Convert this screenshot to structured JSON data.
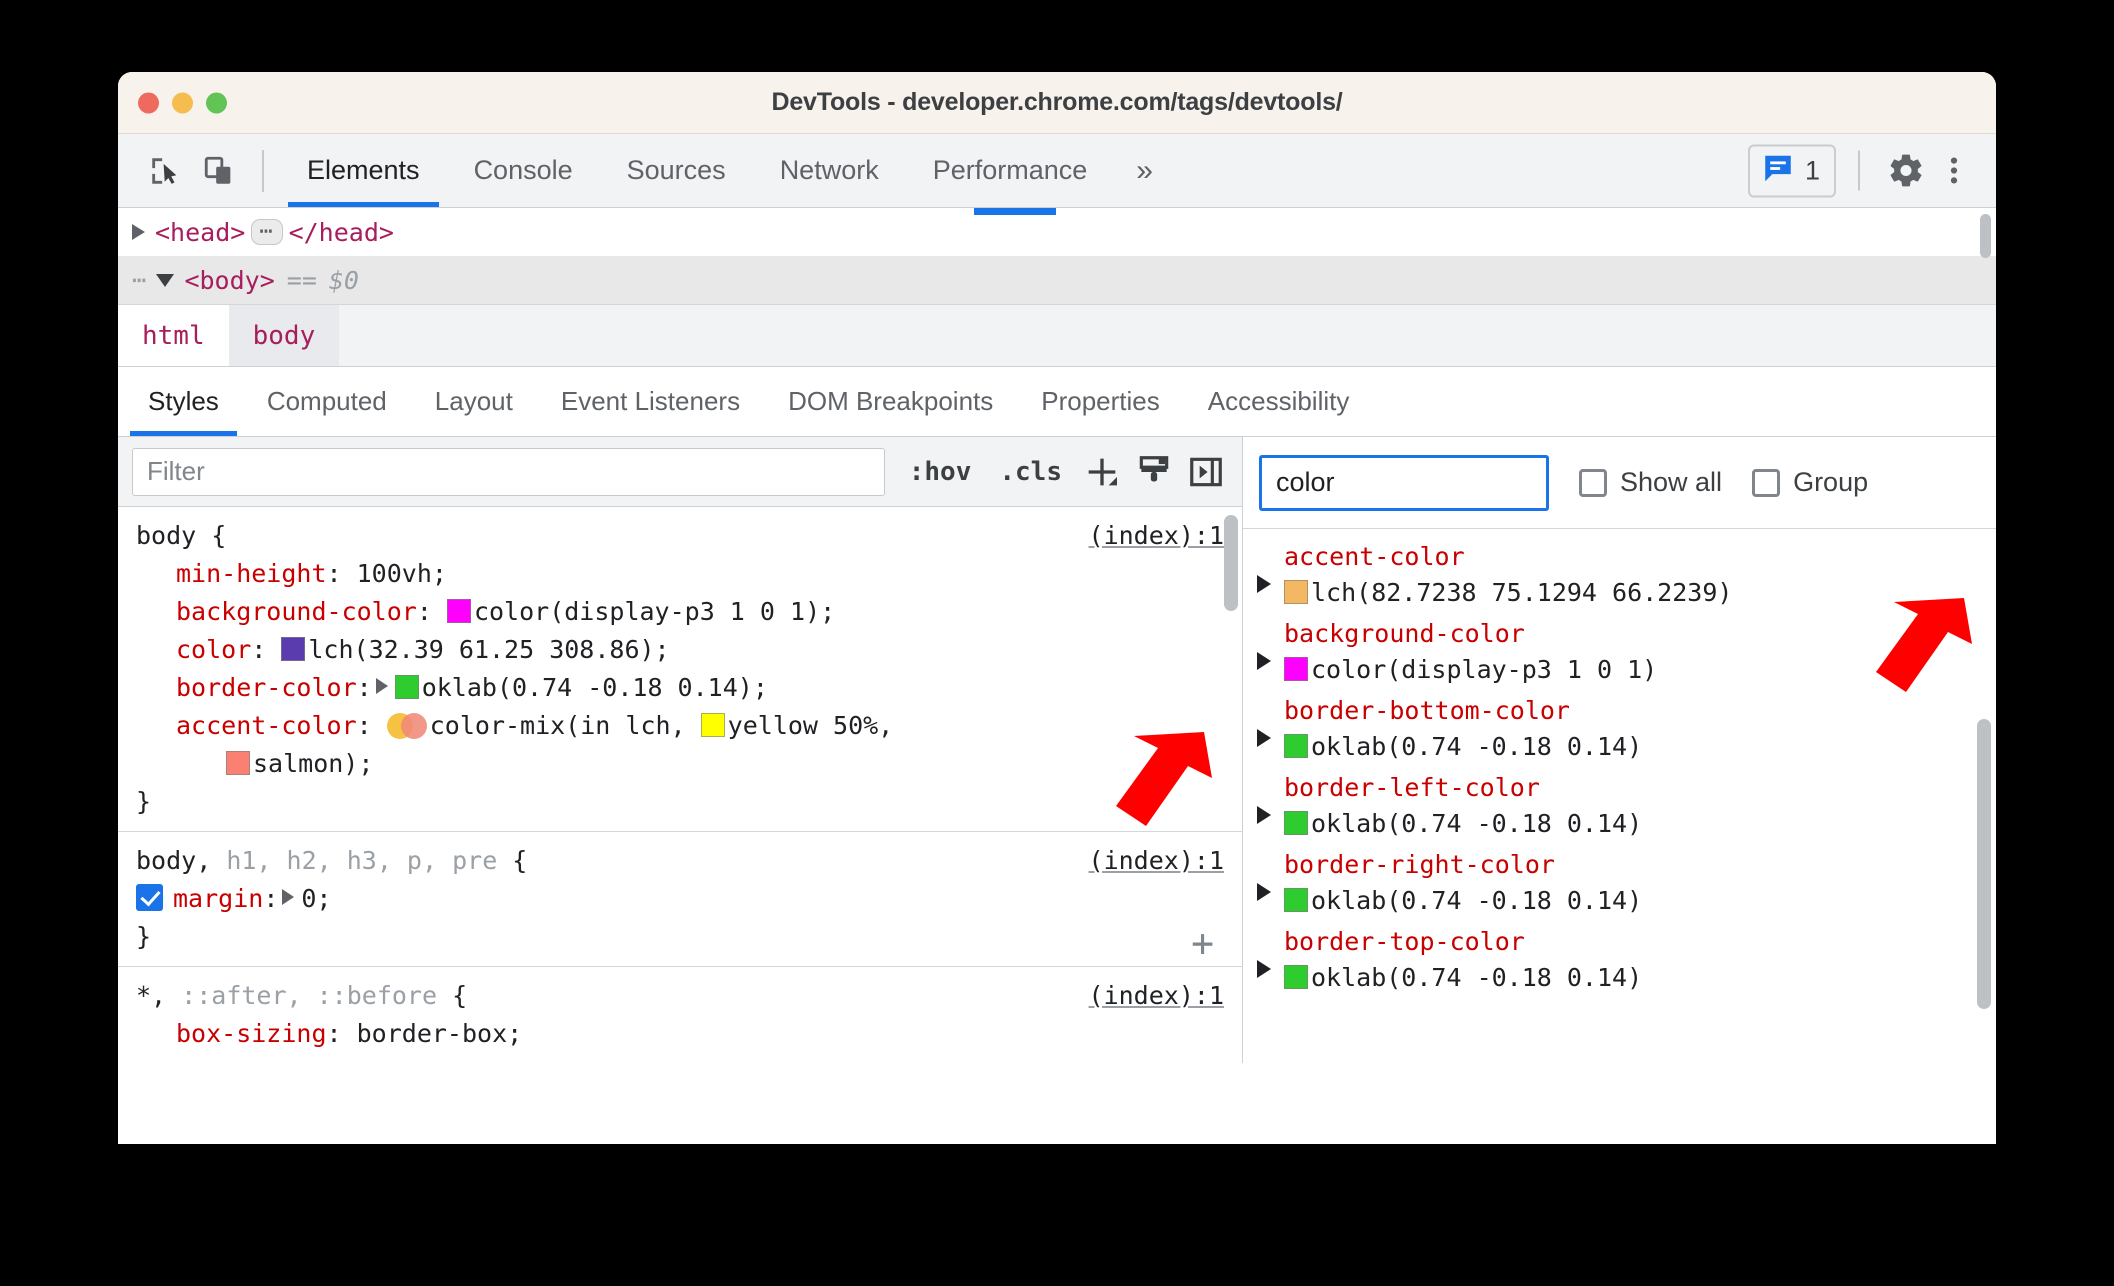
{
  "window": {
    "title": "DevTools - developer.chrome.com/tags/devtools/",
    "traffic_lights": [
      "close",
      "minimize",
      "zoom"
    ]
  },
  "toolbar": {
    "icons": [
      {
        "name": "inspect-element-icon",
        "label": "Inspect"
      },
      {
        "name": "device-toolbar-icon",
        "label": "Toggle device toolbar"
      }
    ],
    "tabs": [
      {
        "label": "Elements",
        "active": true
      },
      {
        "label": "Console",
        "active": false
      },
      {
        "label": "Sources",
        "active": false
      },
      {
        "label": "Network",
        "active": false
      },
      {
        "label": "Performance",
        "active": false
      }
    ],
    "more_tabs_label": "»",
    "issues_count": "1",
    "settings_label": "Settings",
    "menu_label": "Customize and control DevTools"
  },
  "dom_tree": {
    "rows": [
      {
        "gutter": "",
        "marker": "right",
        "open_tag": "<head>",
        "badge": "⋯",
        "close_tag": "</head>",
        "selected": false
      },
      {
        "gutter": "⋯",
        "marker": "down",
        "open_tag": "<body>",
        "eq": "==",
        "ref": "$0",
        "selected": true
      }
    ]
  },
  "breadcrumb": {
    "items": [
      {
        "label": "html",
        "selected": false
      },
      {
        "label": "body",
        "selected": true
      }
    ]
  },
  "sidebar_tabs": [
    {
      "label": "Styles",
      "active": true
    },
    {
      "label": "Computed",
      "active": false
    },
    {
      "label": "Layout",
      "active": false
    },
    {
      "label": "Event Listeners",
      "active": false
    },
    {
      "label": "DOM Breakpoints",
      "active": false
    },
    {
      "label": "Properties",
      "active": false
    },
    {
      "label": "Accessibility",
      "active": false
    }
  ],
  "styles_toolbar": {
    "filter_placeholder": "Filter",
    "filter_value": "",
    "hov_label": ":hov",
    "cls_label": ".cls",
    "new_rule_label": "+",
    "copy_styles_label": "Copy all declarations",
    "computed_sidebar_label": "Toggle computed sidebar"
  },
  "style_rules": [
    {
      "selector_match": "body",
      "selector_rest": "",
      "brace": "{",
      "origin": "(index):1",
      "declarations": [
        {
          "property": "min-height",
          "value": "100vh;",
          "swatch": null
        },
        {
          "property": "background-color",
          "value": "color(display-p3 1 0 1);",
          "swatch": "#ff00ff"
        },
        {
          "property": "color",
          "value": "lch(32.39 61.25 308.86);",
          "swatch": "#5b3cae"
        },
        {
          "property": "border-color",
          "value": "oklab(0.74 -0.18 0.14);",
          "swatch": "#2ecc2e",
          "expandable": true
        },
        {
          "property": "accent-color",
          "value": "color-mix(in lch, ",
          "swatch": "color-mix",
          "inline_swatch_value": "yellow 50%,",
          "inline_swatch": "#ffff00",
          "continuation_value": "salmon);",
          "continuation_swatch": "#fa8072"
        }
      ],
      "closing": "}"
    },
    {
      "selector_match": "body,",
      "selector_rest": " h1, h2, h3, p, pre ",
      "brace": "{",
      "origin": "(index):1",
      "declarations": [
        {
          "property": "margin",
          "value": "0;",
          "checkbox": true,
          "expandable": true
        }
      ],
      "closing": "}",
      "add_button": "+"
    },
    {
      "selector_match": "*,",
      "selector_rest": " ::after, ::before ",
      "brace": "{",
      "origin": "(index):1",
      "declarations": [
        {
          "property": "box-sizing",
          "value": "border-box;",
          "swatch": null
        }
      ],
      "closing": ""
    }
  ],
  "computed": {
    "filter_value": "color",
    "show_all_label": "Show all",
    "show_all_checked": false,
    "group_label": "Group",
    "group_checked": false,
    "properties": [
      {
        "name": "accent-color",
        "value": "lch(82.7238 75.1294 66.2239)",
        "swatch": "#f4b860"
      },
      {
        "name": "background-color",
        "value": "color(display-p3 1 0 1)",
        "swatch": "#ff00ff"
      },
      {
        "name": "border-bottom-color",
        "value": "oklab(0.74 -0.18 0.14)",
        "swatch": "#2ecc2e"
      },
      {
        "name": "border-left-color",
        "value": "oklab(0.74 -0.18 0.14)",
        "swatch": "#2ecc2e"
      },
      {
        "name": "border-right-color",
        "value": "oklab(0.74 -0.18 0.14)",
        "swatch": "#2ecc2e"
      },
      {
        "name": "border-top-color",
        "value": "oklab(0.74 -0.18 0.14)",
        "swatch": "#2ecc2e"
      }
    ]
  },
  "annotations": {
    "arrow_color": "#ff0000",
    "arrow_count": 2
  }
}
